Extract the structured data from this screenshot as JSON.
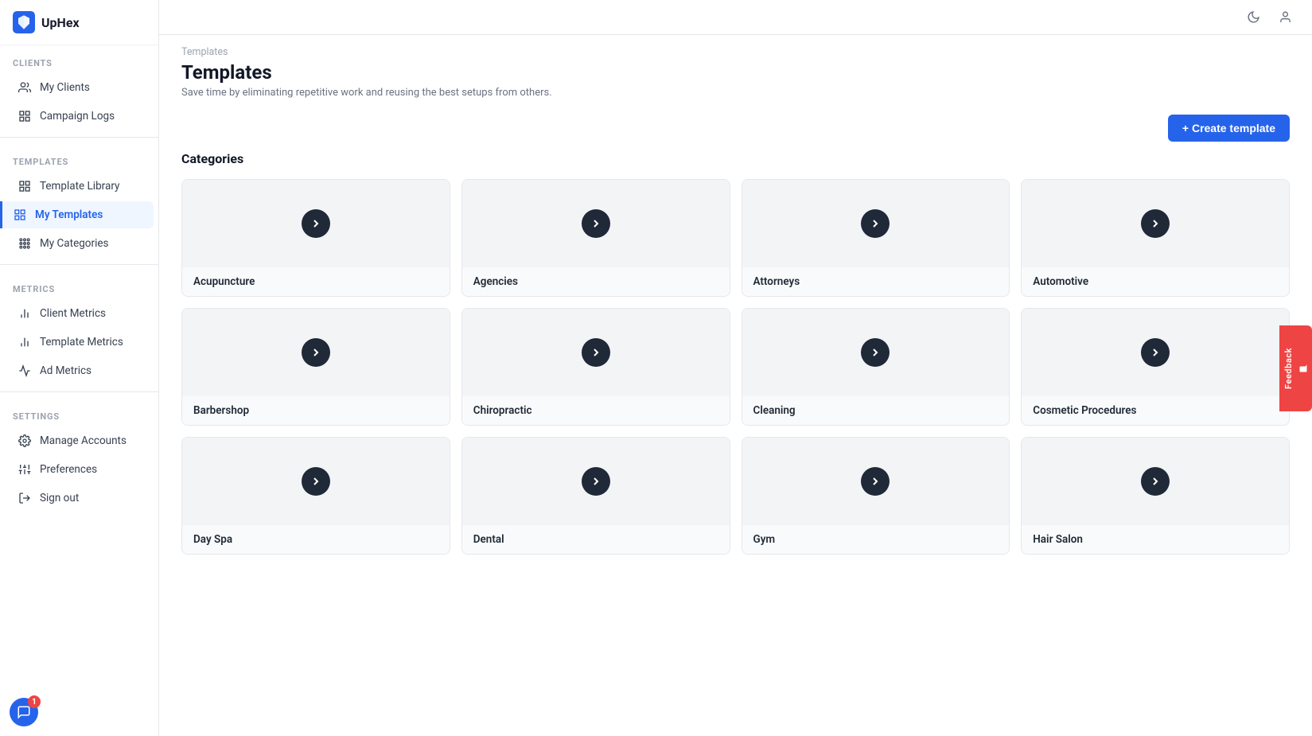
{
  "app": {
    "name": "UpHex"
  },
  "topbar": {
    "moon_icon": "🌙",
    "user_icon": "👤"
  },
  "sidebar": {
    "sections": [
      {
        "label": "CLIENTS",
        "items": [
          {
            "id": "my-clients",
            "label": "My Clients",
            "icon": "people",
            "active": false
          },
          {
            "id": "campaign-logs",
            "label": "Campaign Logs",
            "icon": "list",
            "active": false
          }
        ]
      },
      {
        "label": "TEMPLATES",
        "items": [
          {
            "id": "template-library",
            "label": "Template Library",
            "icon": "grid",
            "active": false
          },
          {
            "id": "my-templates",
            "label": "My Templates",
            "icon": "grid2",
            "active": true
          },
          {
            "id": "my-categories",
            "label": "My Categories",
            "icon": "apps",
            "active": false
          }
        ]
      },
      {
        "label": "METRICS",
        "items": [
          {
            "id": "client-metrics",
            "label": "Client Metrics",
            "icon": "bar-chart",
            "active": false
          },
          {
            "id": "template-metrics",
            "label": "Template Metrics",
            "icon": "bar-chart2",
            "active": false
          },
          {
            "id": "ad-metrics",
            "label": "Ad Metrics",
            "icon": "chart",
            "active": false
          }
        ]
      },
      {
        "label": "SETTINGS",
        "items": [
          {
            "id": "manage-accounts",
            "label": "Manage Accounts",
            "icon": "settings",
            "active": false
          },
          {
            "id": "preferences",
            "label": "Preferences",
            "icon": "sliders",
            "active": false
          },
          {
            "id": "sign-out",
            "label": "Sign out",
            "icon": "logout",
            "active": false
          }
        ]
      }
    ],
    "chat_badge": "1"
  },
  "breadcrumb": "Templates",
  "page": {
    "title": "Templates",
    "subtitle": "Save time by eliminating repetitive work and reusing the best setups from others.",
    "create_button_label": "+ Create template"
  },
  "categories": {
    "section_title": "Categories",
    "items": [
      {
        "id": "acupuncture",
        "label": "Acupuncture"
      },
      {
        "id": "agencies",
        "label": "Agencies"
      },
      {
        "id": "attorneys",
        "label": "Attorneys"
      },
      {
        "id": "automotive",
        "label": "Automotive"
      },
      {
        "id": "barbershop",
        "label": "Barbershop"
      },
      {
        "id": "chiropractic",
        "label": "Chiropractic"
      },
      {
        "id": "cleaning",
        "label": "Cleaning"
      },
      {
        "id": "cosmetic-procedures",
        "label": "Cosmetic Procedures"
      },
      {
        "id": "day-spa",
        "label": "Day Spa"
      },
      {
        "id": "dental",
        "label": "Dental"
      },
      {
        "id": "gym",
        "label": "Gym"
      },
      {
        "id": "hair-salon",
        "label": "Hair Salon"
      }
    ]
  },
  "feedback": {
    "label": "Feedback"
  }
}
